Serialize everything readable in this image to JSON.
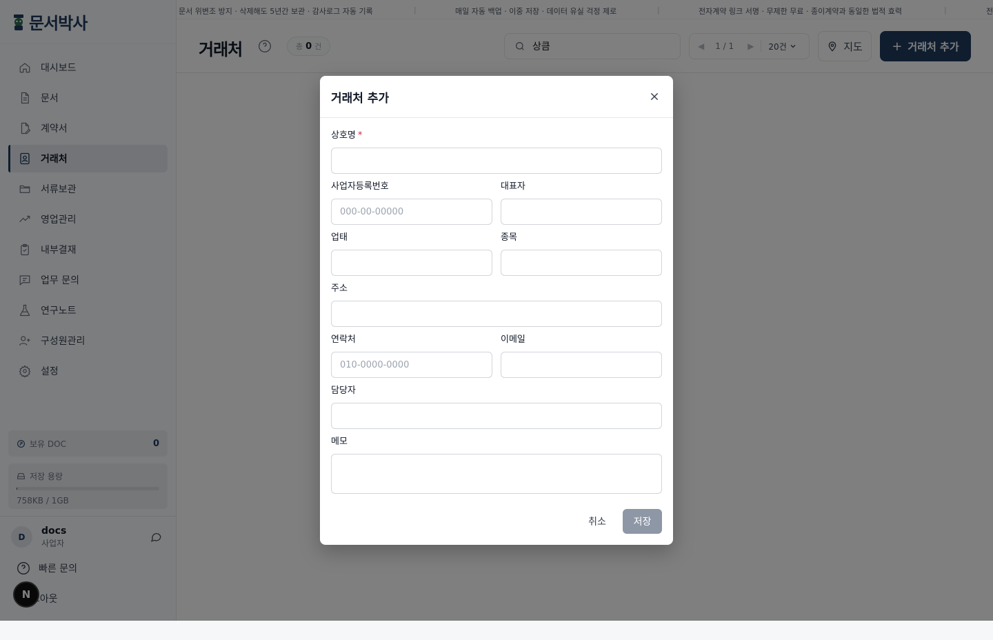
{
  "app": {
    "logo_text": "문서박사"
  },
  "sidebar": {
    "items": [
      {
        "label": "대시보드",
        "icon": "home-icon"
      },
      {
        "label": "문서",
        "icon": "document-icon"
      },
      {
        "label": "계약서",
        "icon": "contract-icon"
      },
      {
        "label": "거래처",
        "icon": "contact-book-icon",
        "active": true
      },
      {
        "label": "서류보관",
        "icon": "folder-icon"
      },
      {
        "label": "영업관리",
        "icon": "trending-up-icon"
      },
      {
        "label": "내부결재",
        "icon": "clipboard-check-icon"
      },
      {
        "label": "업무 문의",
        "icon": "message-icon"
      },
      {
        "label": "연구노트",
        "icon": "flask-icon"
      },
      {
        "label": "구성원관리",
        "icon": "user-plus-icon"
      },
      {
        "label": "설정",
        "icon": "gear-icon"
      }
    ],
    "doc": {
      "label": "보유 DOC",
      "value": "0"
    },
    "storage": {
      "label": "저장 용량",
      "text": "758KB / 1GB",
      "used_fraction": 0.0007
    },
    "user": {
      "initial": "D",
      "name": "docs",
      "role": "사업자"
    },
    "quick_inquiry": "빠른 문의",
    "logout": "로그아웃",
    "badge": "N"
  },
  "ticker": {
    "items": [
      "문서 위변조 방지 · 삭제해도 5년간 보관 · 감사로그 자동 기록",
      "매일 자동 백업 · 이중 저장 · 데이터 유실 걱정 제로",
      "전자계약 링크 서명 · 무제한 무료 · 종이계약과 동일한 법적 효력",
      "전"
    ],
    "separator": "|"
  },
  "header": {
    "title": "거래처",
    "count_prefix": "총",
    "count": "0",
    "count_suffix": "건",
    "search_value": "상큼",
    "page": "1 / 1",
    "page_size": "20건",
    "map_label": "지도",
    "add_label": "거래처 추가"
  },
  "modal": {
    "title": "거래처 추가",
    "fields": {
      "company": {
        "label": "상호명",
        "required_mark": "*",
        "placeholder": ""
      },
      "biz_no": {
        "label": "사업자등록번호",
        "placeholder": "000-00-00000"
      },
      "ceo": {
        "label": "대표자",
        "placeholder": ""
      },
      "biz_type": {
        "label": "업태",
        "placeholder": ""
      },
      "biz_item": {
        "label": "종목",
        "placeholder": ""
      },
      "address": {
        "label": "주소",
        "placeholder": ""
      },
      "phone": {
        "label": "연락처",
        "placeholder": "010-0000-0000"
      },
      "email": {
        "label": "이메일",
        "placeholder": ""
      },
      "manager": {
        "label": "담당자",
        "placeholder": ""
      },
      "memo": {
        "label": "메모",
        "placeholder": ""
      }
    },
    "cancel_label": "취소",
    "save_label": "저장"
  },
  "colors": {
    "brand": "#1e3a5f",
    "required": "#e11d48",
    "save_disabled": "#8e97a6"
  }
}
